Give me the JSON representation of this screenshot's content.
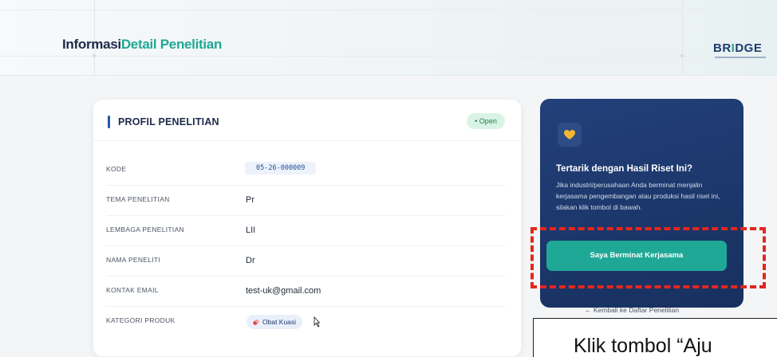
{
  "header": {
    "title_part1": "Informasi",
    "title_part2": "Detail Penelitian",
    "logo_text_a": "BR",
    "logo_text_b": "I",
    "logo_text_c": "DGE"
  },
  "profile": {
    "section_title": "PROFIL PENELITIAN",
    "status": "• Open",
    "rows": [
      {
        "label": "KODE",
        "value": "05-26-000009"
      },
      {
        "label": "TEMA PENELITIAN",
        "value": "Pr"
      },
      {
        "label": "LEMBAGA PENELITIAN",
        "value": "LII"
      },
      {
        "label": "NAMA PENELITI",
        "value": "Dr"
      },
      {
        "label": "KONTAK EMAIL",
        "value": "test-uk@gmail.com"
      },
      {
        "label": "KATEGORI PRODUK",
        "value": "Obat Kuasi"
      }
    ]
  },
  "cta": {
    "title": "Tertarik dengan Hasil Riset Ini?",
    "description": "Jika industri/perusahaan Anda berminat menjalin kerjasama pengembangan atau produksi hasil riset ini, silakan klik tombol di bawah.",
    "button_label": "Saya Berminat Kerjasama"
  },
  "back_link": "← Kembali ke Daftar Penelitian",
  "callout": {
    "text": "Klik tombol “Aju"
  },
  "colors": {
    "accent_teal": "#1fa896",
    "navy": "#1e2a4a",
    "cta_bg": "#1b3669",
    "highlight_red": "#e3261f"
  },
  "icons": [
    "heart-hand-icon",
    "pill-icon",
    "cursor-icon"
  ]
}
